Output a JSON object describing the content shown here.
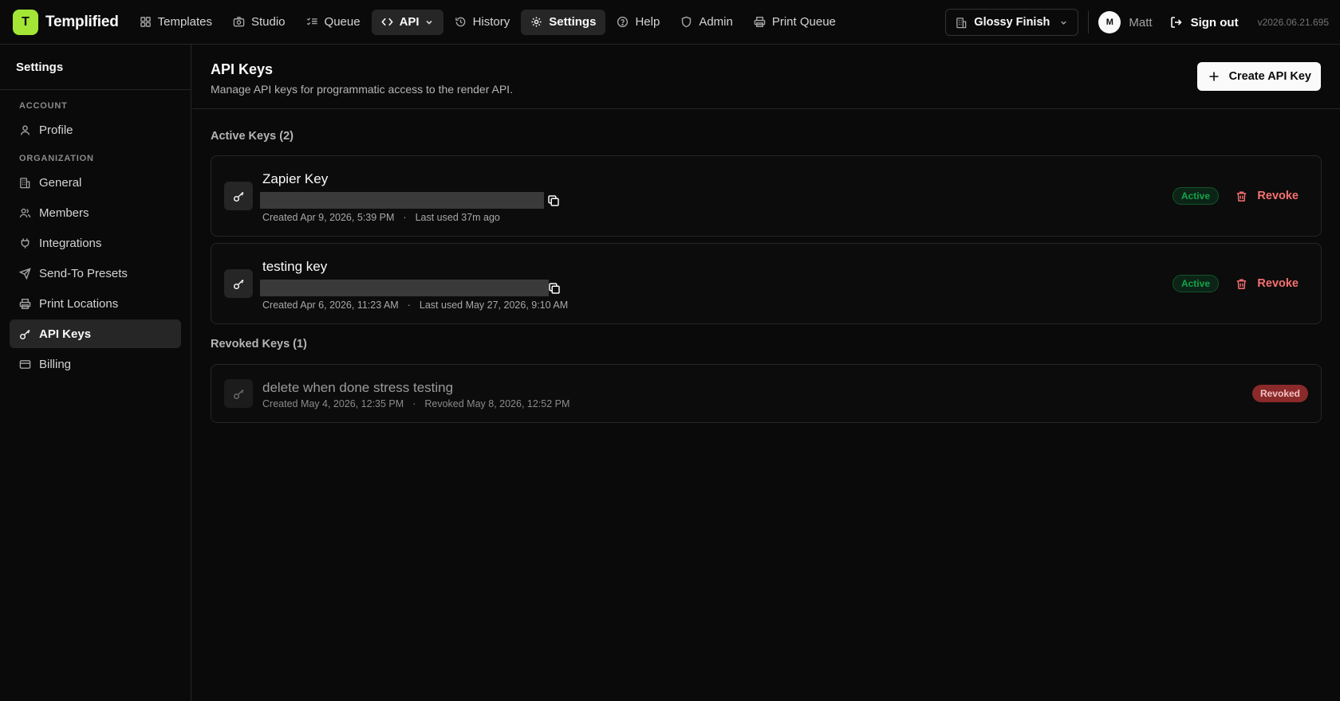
{
  "brand": {
    "logo_letter": "T",
    "name": "Templified",
    "logo_color": "#a3e635"
  },
  "nav": [
    {
      "key": "templates",
      "label": "Templates",
      "icon": "grid-icon"
    },
    {
      "key": "studio",
      "label": "Studio",
      "icon": "camera-icon"
    },
    {
      "key": "queue",
      "label": "Queue",
      "icon": "list-checks-icon"
    },
    {
      "key": "api",
      "label": "API",
      "icon": "code-icon",
      "dropdown": true
    },
    {
      "key": "history",
      "label": "History",
      "icon": "history-icon"
    },
    {
      "key": "settings",
      "label": "Settings",
      "icon": "gear-icon",
      "selected": true
    },
    {
      "key": "help",
      "label": "Help",
      "icon": "help-circle-icon"
    },
    {
      "key": "admin",
      "label": "Admin",
      "icon": "shield-icon"
    },
    {
      "key": "print_queue",
      "label": "Print Queue",
      "icon": "printer-icon"
    }
  ],
  "workspace": {
    "name": "Glossy Finish",
    "icon": "building-icon"
  },
  "user": {
    "initial": "M",
    "name": "Matt"
  },
  "signout_label": "Sign out",
  "version": "v2026.06.21.695",
  "sidebar": {
    "title": "Settings",
    "sections": [
      {
        "label": "ACCOUNT",
        "items": [
          {
            "label": "Profile",
            "icon": "user-icon"
          }
        ]
      },
      {
        "label": "ORGANIZATION",
        "items": [
          {
            "label": "General",
            "icon": "building-icon"
          },
          {
            "label": "Members",
            "icon": "users-icon"
          },
          {
            "label": "Integrations",
            "icon": "plug-icon"
          },
          {
            "label": "Send-To Presets",
            "icon": "send-icon"
          },
          {
            "label": "Print Locations",
            "icon": "printer-icon"
          },
          {
            "label": "API Keys",
            "icon": "key-icon",
            "active": true
          },
          {
            "label": "Billing",
            "icon": "credit-card-icon"
          }
        ]
      }
    ]
  },
  "page": {
    "title": "API Keys",
    "subtitle": "Manage API keys for programmatic access to the render API.",
    "create_button": "Create API Key"
  },
  "active_section_label": "Active Keys (2)",
  "active_keys": [
    {
      "name": "Zapier Key",
      "created": "Created Apr 9, 2026, 5:39 PM",
      "last_used": "Last used 37m ago",
      "status": "Active",
      "revoke_label": "Revoke"
    },
    {
      "name": "testing key",
      "created": "Created Apr 6, 2026, 11:23 AM",
      "last_used": "Last used May 27, 2026, 9:10 AM",
      "status": "Active",
      "revoke_label": "Revoke"
    }
  ],
  "revoked_section_label": "Revoked Keys (1)",
  "revoked_keys": [
    {
      "name": "delete when done stress testing",
      "created": "Created May 4, 2026, 12:35 PM",
      "revoked": "Revoked May 8, 2026, 12:52 PM",
      "status": "Revoked"
    }
  ],
  "meta_separator": "·",
  "colors": {
    "accent": "#a3e635",
    "active_badge": "#16a34a",
    "revoke": "#f87171",
    "revoked_badge": "#8b2a2a"
  }
}
